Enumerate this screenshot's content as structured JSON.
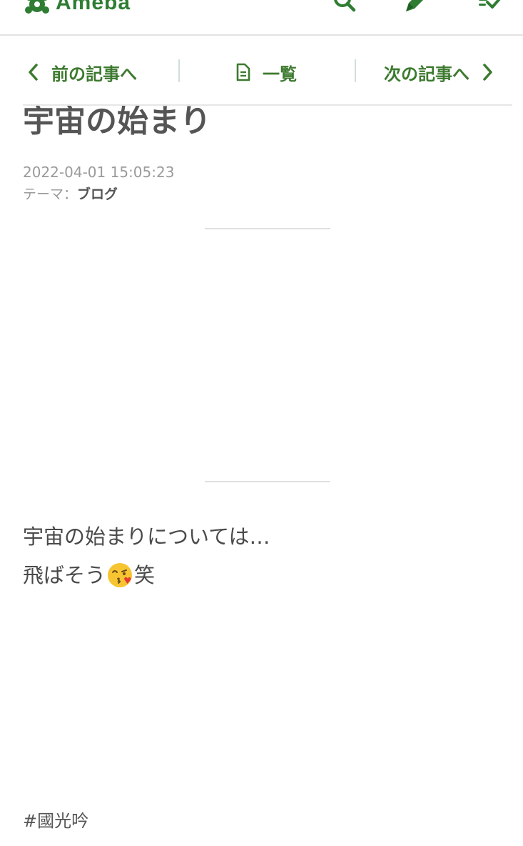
{
  "header": {
    "logo_text": "Ameba",
    "icons": [
      "search-icon",
      "pen-icon",
      "checklist-icon"
    ],
    "brand_color": "#2e7d32"
  },
  "article_nav": {
    "prev_label": "前の記事へ",
    "list_label": "一覧",
    "next_label": "次の記事へ",
    "accent_color": "#3d7a2f"
  },
  "article": {
    "title": "宇宙の始まり",
    "date": "2022-04-01 15:05:23",
    "theme_prefix": "テーマ：",
    "theme": "ブログ",
    "body_line1": "宇宙の始まりについては…",
    "body_line2_before": "飛ばそう",
    "emoji": "face-blowing-kiss",
    "body_line2_after": "笑",
    "hashtag": "#國光吟"
  }
}
